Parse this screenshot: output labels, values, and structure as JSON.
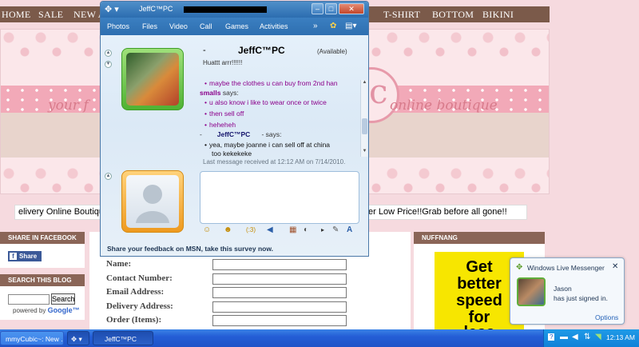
{
  "webpage": {
    "nav": [
      "HOME",
      "SALE",
      "NEW A",
      "T-SHIRT",
      "BOTTOM",
      "BIKINI"
    ],
    "banner": {
      "script_left": "your f",
      "script_right": "online boutique",
      "circle_letter": "c"
    },
    "marquee_left": "elivery Online Boutique",
    "marquee_right": "er Low Price!!Grab before all gone!!",
    "share_facebook": {
      "title": "SHARE IN FACEBOOK",
      "button": "Share",
      "fb_glyph": "f"
    },
    "search_blog": {
      "title": "SEARCH THIS BLOG",
      "button": "Search",
      "powered_by": "powered by",
      "google": "Google™"
    },
    "nuffnang": {
      "title": "NUFFNANG",
      "ad_lines": [
        "Get",
        "better",
        "speed",
        "for",
        "less"
      ]
    },
    "form": {
      "fields": [
        {
          "label": "Name:"
        },
        {
          "label": "Contact Number:"
        },
        {
          "label": "Email Address:"
        },
        {
          "label": "Delivery Address:"
        },
        {
          "label": "Order (Items):"
        }
      ]
    }
  },
  "msn_window": {
    "title": "JeffC™PC",
    "title_icon": "msn-butterfly-icon",
    "window_buttons": {
      "minimize": "–",
      "maximize": "□",
      "close": "✕"
    },
    "menu": [
      "Photos",
      "Files",
      "Video",
      "Call",
      "Games",
      "Activities"
    ],
    "more": "»",
    "contact": {
      "dash": "-",
      "name": "JeffC™PC",
      "status": "(Available)",
      "personal_message": "Huattt arrr!!!!!!"
    },
    "chat": [
      {
        "type": "msg",
        "text": "maybe the clothes u can buy from 2nd han"
      },
      {
        "type": "speaker",
        "name": "smalls",
        "says": "says:"
      },
      {
        "type": "msg",
        "text": "u also know i like to wear once or twice"
      },
      {
        "type": "msg",
        "text": "then sell off"
      },
      {
        "type": "msg",
        "text": "heheheh"
      },
      {
        "type": "speaker",
        "name": "JeffC™PC",
        "says": "- says:",
        "prefix": "-"
      },
      {
        "type": "msg-self",
        "text": "yea, maybe joanne i can sell off at china"
      },
      {
        "type": "msg-self-cont",
        "text": "too kekekeke"
      }
    ],
    "last_message": "Last message received at 12:12 AM on 7/14/2010.",
    "feedback": "Share your feedback on MSN, take this survey now.",
    "toolbar": {
      "emoticon": "☺",
      "wink": "☻",
      "nudge": "(:3)",
      "voice": "◀",
      "background": "▦",
      "font": "A"
    }
  },
  "taskbar": {
    "tasks": [
      "mmyCubic~: New ...",
      "JeffC™PC"
    ],
    "group_icon": "msn-icon",
    "clock": "12:13 AM"
  },
  "toast": {
    "title": "Windows Live Messenger",
    "close": "✕",
    "name": "Jason",
    "message": "has just signed in.",
    "options": "Options"
  }
}
